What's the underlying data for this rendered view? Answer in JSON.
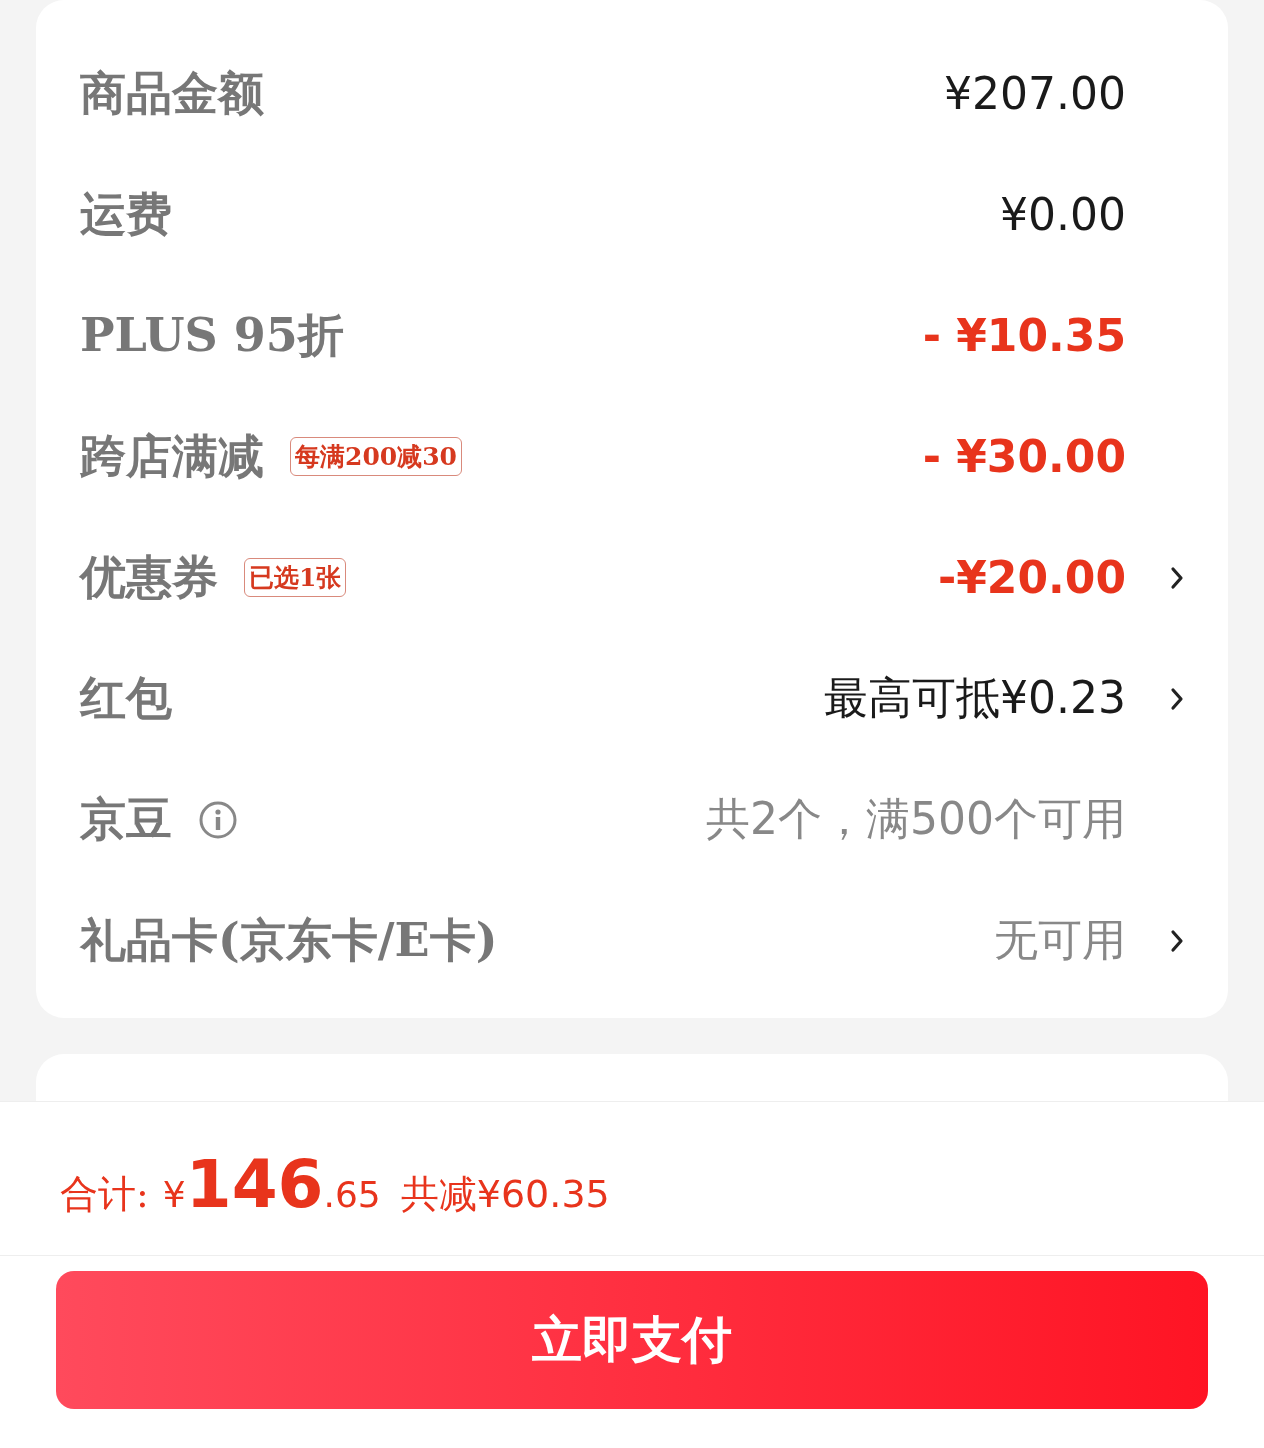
{
  "rows": [
    {
      "label": "商品金额",
      "value": "¥207.00",
      "kind": "plain",
      "chevron": false
    },
    {
      "label": "运费",
      "value": "¥0.00",
      "kind": "plain",
      "chevron": false
    },
    {
      "label": "PLUS 95折",
      "value": "- ¥10.35",
      "kind": "discount",
      "chevron": false
    },
    {
      "label": "跨店满减",
      "tag": "每满200减30",
      "value": "- ¥30.00",
      "kind": "discount",
      "chevron": false
    },
    {
      "label": "优惠券",
      "tag": "已选1张",
      "value": "-¥20.00",
      "kind": "discount",
      "chevron": true
    },
    {
      "label": "红包",
      "value": "最高可抵¥0.23",
      "kind": "plain",
      "chevron": true
    },
    {
      "label": "京豆",
      "info": true,
      "value": "共2个，满500个可用",
      "kind": "muted",
      "chevron": false
    },
    {
      "label": "礼品卡(京东卡/E卡)",
      "value": "无可用",
      "kind": "muted",
      "chevron": true
    }
  ],
  "total": {
    "label": "合计:",
    "currency": "¥",
    "integer": "146",
    "decimal": ".65",
    "saved": "共减¥60.35"
  },
  "pay_button": "立即支付"
}
